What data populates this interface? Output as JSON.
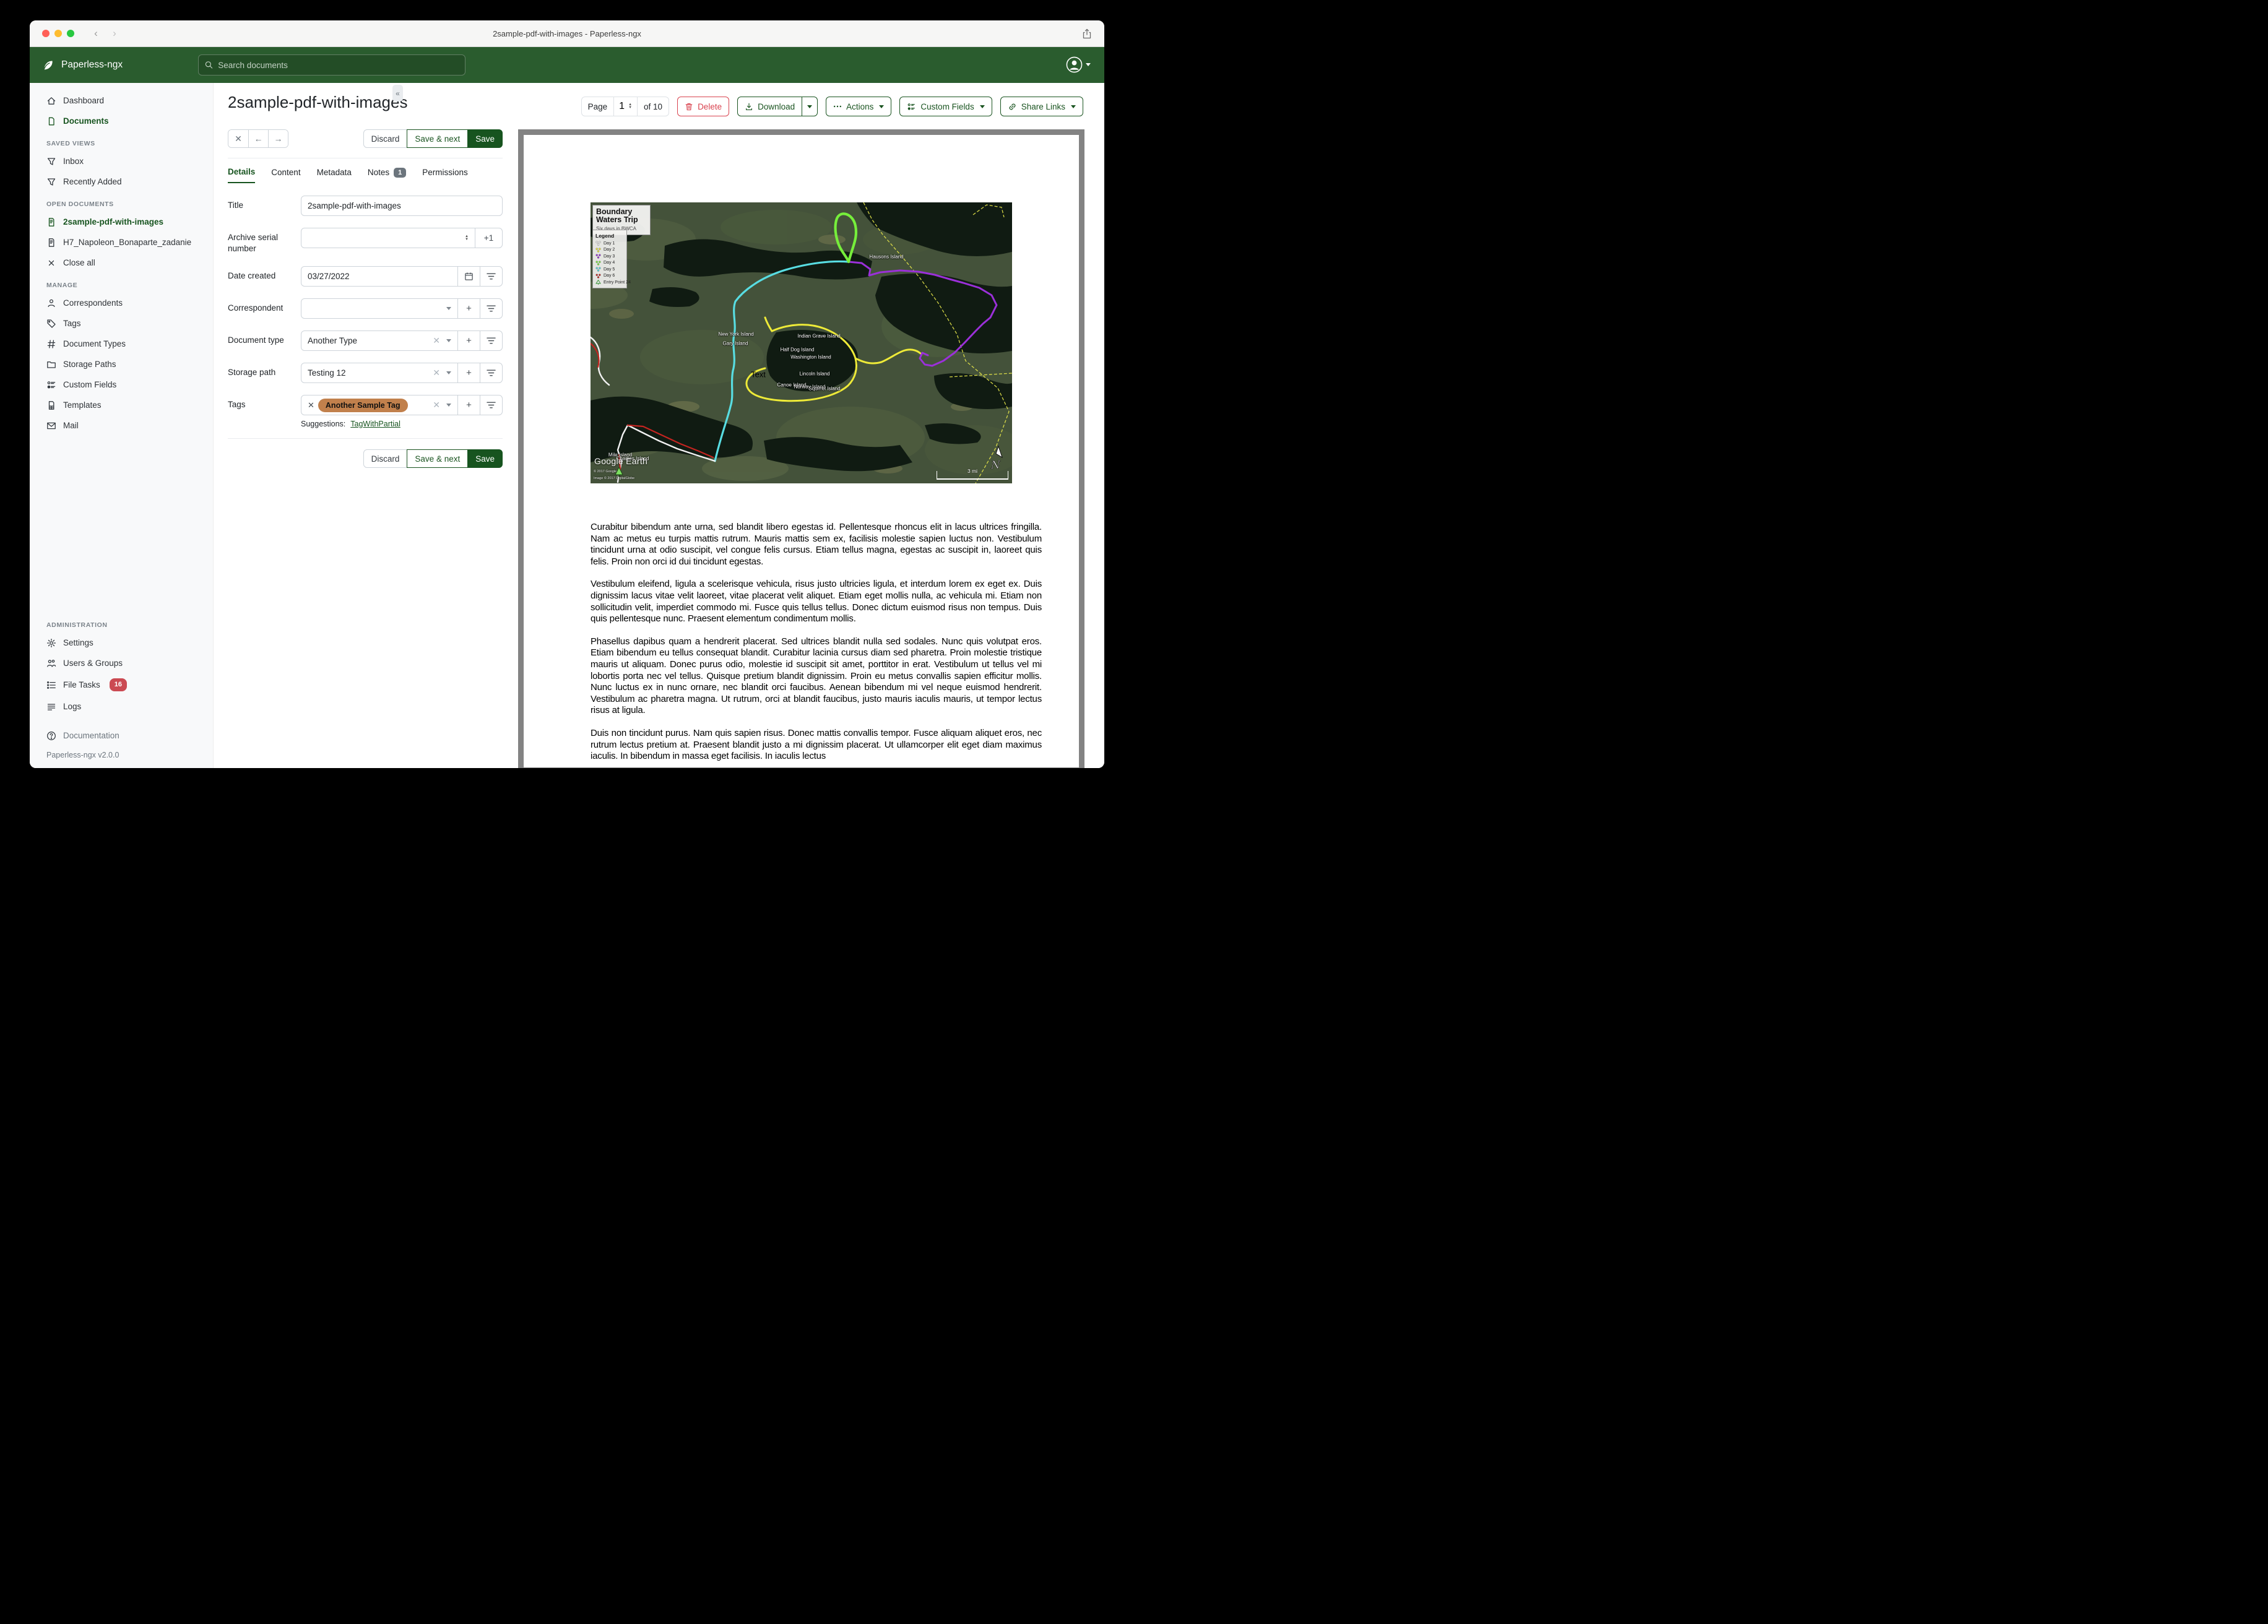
{
  "titlebar": {
    "title": "2sample-pdf-with-images - Paperless-ngx"
  },
  "navbar": {
    "brand": "Paperless-ngx",
    "search_placeholder": "Search documents"
  },
  "colors": {
    "accent": "#17541f",
    "header_green": "#2a5c2e",
    "danger": "#d9434f",
    "tag_chip": "#c1804c",
    "file_tasks_badge": "#cb4a52",
    "notes_badge": "#6c757d"
  },
  "sidebar": {
    "primary": [
      {
        "label": "Dashboard"
      },
      {
        "label": "Documents"
      }
    ],
    "saved_views": {
      "title": "SAVED VIEWS",
      "items": [
        {
          "label": "Inbox"
        },
        {
          "label": "Recently Added"
        }
      ]
    },
    "open_documents": {
      "title": "OPEN DOCUMENTS",
      "items": [
        {
          "label": "2sample-pdf-with-images"
        },
        {
          "label": "H7_Napoleon_Bonaparte_zadanie"
        },
        {
          "label": "Close all"
        }
      ]
    },
    "manage": {
      "title": "MANAGE",
      "items": [
        {
          "label": "Correspondents"
        },
        {
          "label": "Tags"
        },
        {
          "label": "Document Types"
        },
        {
          "label": "Storage Paths"
        },
        {
          "label": "Custom Fields"
        },
        {
          "label": "Templates"
        },
        {
          "label": "Mail"
        }
      ]
    },
    "administration": {
      "title": "ADMINISTRATION",
      "items": [
        {
          "label": "Settings"
        },
        {
          "label": "Users & Groups"
        },
        {
          "label": "File Tasks",
          "badge": "16"
        },
        {
          "label": "Logs"
        }
      ]
    },
    "documentation": "Documentation",
    "version": "Paperless-ngx v2.0.0"
  },
  "toolbar": {
    "page_label": "Page",
    "page_value": "1",
    "page_of": "of 10",
    "delete_label": "Delete",
    "download_label": "Download",
    "actions_label": "Actions",
    "custom_fields_label": "Custom Fields",
    "share_links_label": "Share Links"
  },
  "editor": {
    "title": "2sample-pdf-with-images",
    "discard_label": "Discard",
    "save_next_label": "Save & next",
    "save_label": "Save",
    "tabs": {
      "details": "Details",
      "content": "Content",
      "metadata": "Metadata",
      "notes": "Notes",
      "notes_badge": "1",
      "permissions": "Permissions"
    },
    "fields": {
      "title_label": "Title",
      "title_value": "2sample-pdf-with-images",
      "asn_label": "Archive serial number",
      "asn_value": "",
      "asn_increment": "+1",
      "date_label": "Date created",
      "date_value": "03/27/2022",
      "correspondent_label": "Correspondent",
      "correspondent_value": "",
      "doctype_label": "Document type",
      "doctype_value": "Another Type",
      "storage_label": "Storage path",
      "storage_value": "Testing 12",
      "tags_label": "Tags",
      "tag_chip": "Another Sample Tag",
      "suggestions_label": "Suggestions:",
      "suggestion_link": "TagWithPartial"
    }
  },
  "document": {
    "map": {
      "title": "Boundary Waters Trip",
      "subtitle": "Six days in BWCA",
      "legend_title": "Legend",
      "legend": [
        {
          "label": "Day 1",
          "color": "#f2f2f2"
        },
        {
          "label": "Day 2",
          "color": "#eeea38"
        },
        {
          "label": "Day 3",
          "color": "#9b30d9"
        },
        {
          "label": "Day 4",
          "color": "#76ee3b"
        },
        {
          "label": "Day 5",
          "color": "#58dde2"
        },
        {
          "label": "Day 6",
          "color": "#c42420"
        },
        {
          "label": "Entry Point 24",
          "color": "#59c24a"
        }
      ],
      "labels": [
        {
          "text": "Hausons Island"
        },
        {
          "text": "New York Island"
        },
        {
          "text": "Gary Island"
        },
        {
          "text": "Indian Grave Island"
        },
        {
          "text": "Half Dog Island"
        },
        {
          "text": "Washington Island"
        },
        {
          "text": "Lincoln Island"
        },
        {
          "text": "Canoe Island"
        },
        {
          "text": "Norway Island"
        },
        {
          "text": "Squirrel Island"
        },
        {
          "text": "Mile Island"
        },
        {
          "text": "Charlies Island"
        },
        {
          "text": "Text"
        }
      ],
      "watermark": "Google Earth",
      "copyright1": "© 2017 Google",
      "copyright2": "Image © 2017 DigitalGlobe",
      "scale_label": "3 mi",
      "compass": "N"
    },
    "paragraphs": [
      "Curabitur bibendum ante urna, sed blandit libero egestas id. Pellentesque rhoncus elit in lacus ultrices fringilla. Nam ac metus eu turpis mattis rutrum. Mauris mattis sem ex, facilisis molestie sapien luctus non. Vestibulum tincidunt urna at odio suscipit, vel congue felis cursus. Etiam tellus magna, egestas ac suscipit in, laoreet quis felis. Proin non orci id dui tincidunt egestas.",
      "Vestibulum eleifend, ligula a scelerisque vehicula, risus justo ultricies ligula, et interdum lorem ex eget ex. Duis dignissim lacus vitae velit laoreet, vitae placerat velit aliquet. Etiam eget mollis nulla, ac vehicula mi. Etiam non sollicitudin velit, imperdiet commodo mi. Fusce quis tellus tellus. Donec dictum euismod risus non tempus. Duis quis pellentesque nunc. Praesent elementum condimentum mollis.",
      "Phasellus dapibus quam a hendrerit placerat. Sed ultrices blandit nulla sed sodales. Nunc quis volutpat eros. Etiam bibendum eu tellus consequat blandit. Curabitur lacinia cursus diam sed pharetra. Proin molestie tristique mauris ut aliquam. Donec purus odio, molestie id suscipit sit amet, porttitor in erat. Vestibulum ut tellus vel mi lobortis porta nec vel tellus. Quisque pretium blandit dignissim. Proin eu metus convallis sapien efficitur mollis. Nunc luctus ex in nunc ornare, nec blandit orci faucibus. Aenean bibendum mi vel neque euismod hendrerit. Vestibulum ac pharetra magna. Ut rutrum, orci at blandit faucibus, justo mauris iaculis mauris, ut tempor lectus risus at ligula.",
      "Duis non tincidunt purus. Nam quis sapien risus. Donec mattis convallis tempor. Fusce aliquam aliquet eros, nec rutrum lectus pretium at. Praesent blandit justo a mi dignissim placerat. Ut ullamcorper elit eget diam maximus iaculis. In bibendum in massa eget facilisis. In iaculis lectus"
    ]
  }
}
